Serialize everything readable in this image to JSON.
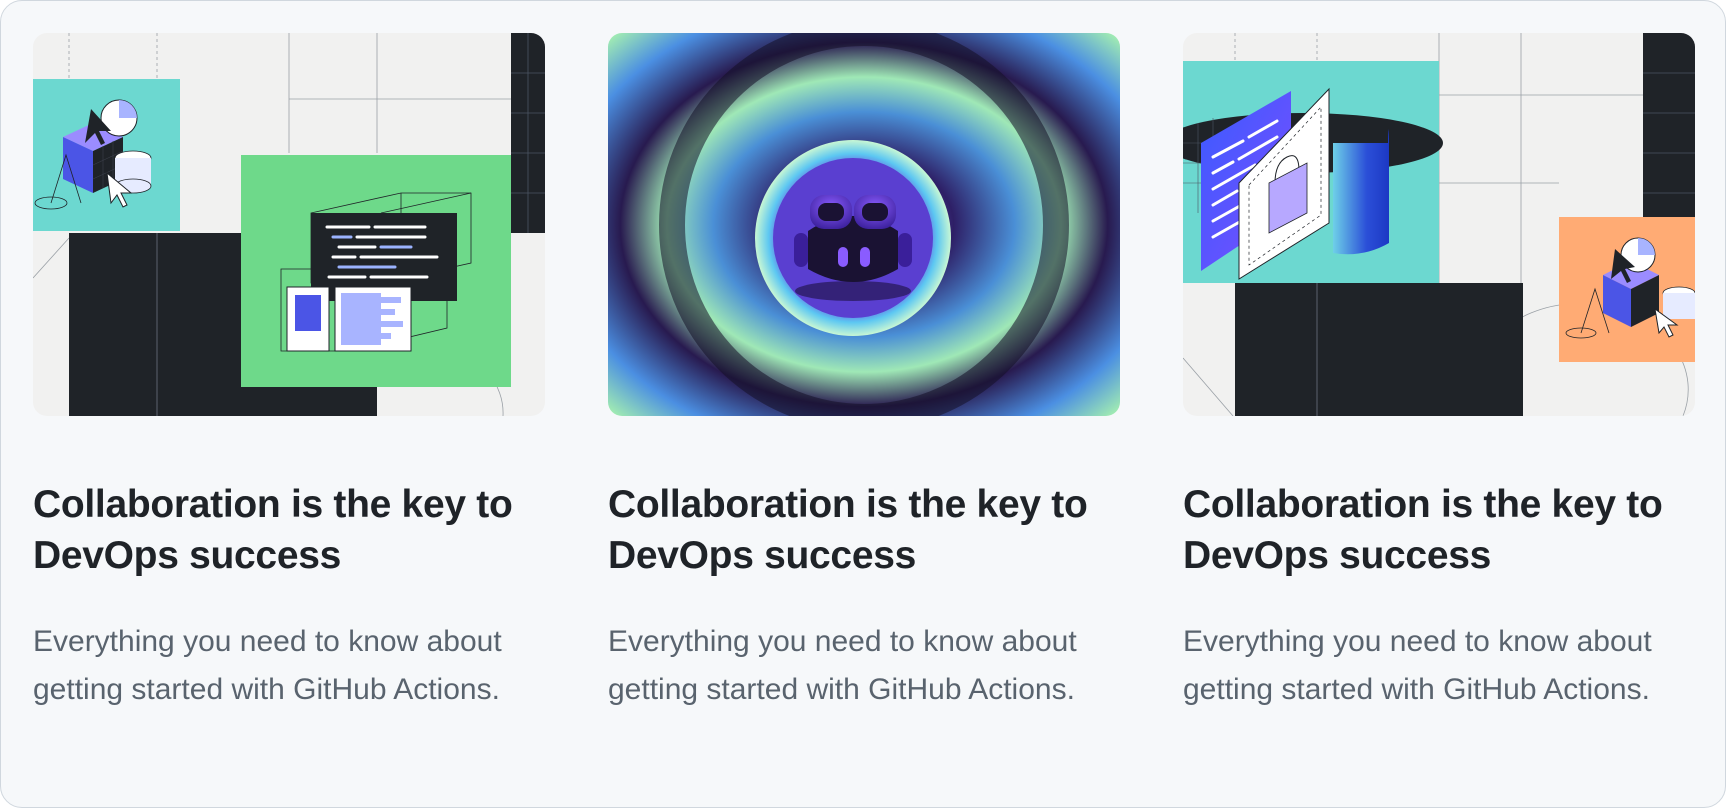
{
  "cards": [
    {
      "illustration": "isometric-shapes-and-code-window",
      "title": "Collaboration is the key to DevOps success",
      "description": "Everything you need to know about getting started with GitHub Actions."
    },
    {
      "illustration": "copilot-robot-in-gradient-rings",
      "title": "Collaboration is the key to DevOps success",
      "description": "Everything you need to know about getting started with GitHub Actions."
    },
    {
      "illustration": "security-lock-window-and-shapes",
      "title": "Collaboration is the key to DevOps success",
      "description": "Everything you need to know about getting started with GitHub Actions."
    }
  ],
  "colors": {
    "page_background": "#f6f8fa",
    "title_text": "#1f2328",
    "description_text": "#59636e",
    "accent_teal": "#6cd8d0",
    "accent_green": "#6ed98a",
    "accent_orange": "#ffab74",
    "accent_purple": "#7c4dff",
    "dark": "#1f2328"
  }
}
